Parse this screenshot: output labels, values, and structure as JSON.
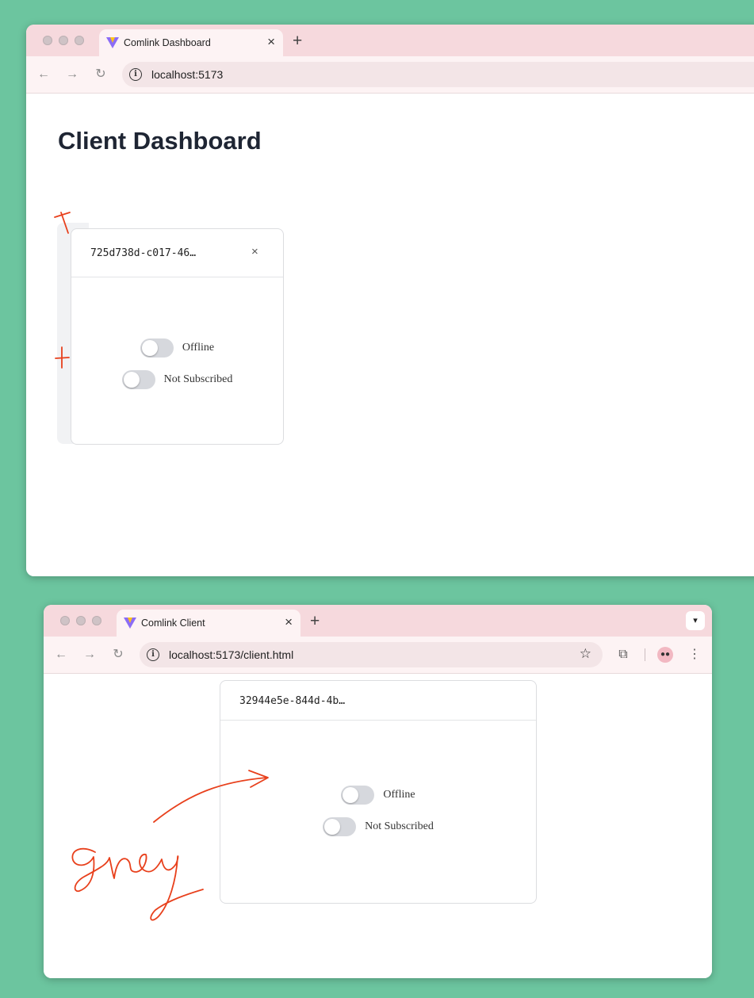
{
  "dashboard_window": {
    "tab_title": "Comlink Dashboard",
    "new_tab_label": "+",
    "url": "localhost:5173",
    "page_title": "Client Dashboard",
    "client_card": {
      "client_id": "725d738d-c017-46…",
      "close_label": "×",
      "offline_label": "Offline",
      "offline_on": false,
      "subscribed_label": "Not Subscribed",
      "subscribed_on": false
    }
  },
  "client_window": {
    "tab_title": "Comlink Client",
    "new_tab_label": "+",
    "url": "localhost:5173/client.html",
    "client_card": {
      "client_id": "32944e5e-844d-4b…",
      "offline_label": "Offline",
      "offline_on": false,
      "subscribed_label": "Not Subscribed",
      "subscribed_on": false
    }
  },
  "annotations": {
    "handwritten_note": "grey",
    "annotation_color": "#e8401c"
  },
  "colors": {
    "desktop_background": "#6cc59f",
    "tab_strip": "#f6d9dd",
    "toggle_off": "#d6d8dd",
    "heading_text": "#1e2533"
  },
  "icons": [
    "back-arrow-icon",
    "forward-arrow-icon",
    "reload-icon",
    "info-icon",
    "bookmark-star-icon",
    "extensions-icon",
    "profile-avatar-icon",
    "more-menu-icon",
    "tab-search-icon",
    "vite-favicon-icon",
    "close-icon"
  ]
}
